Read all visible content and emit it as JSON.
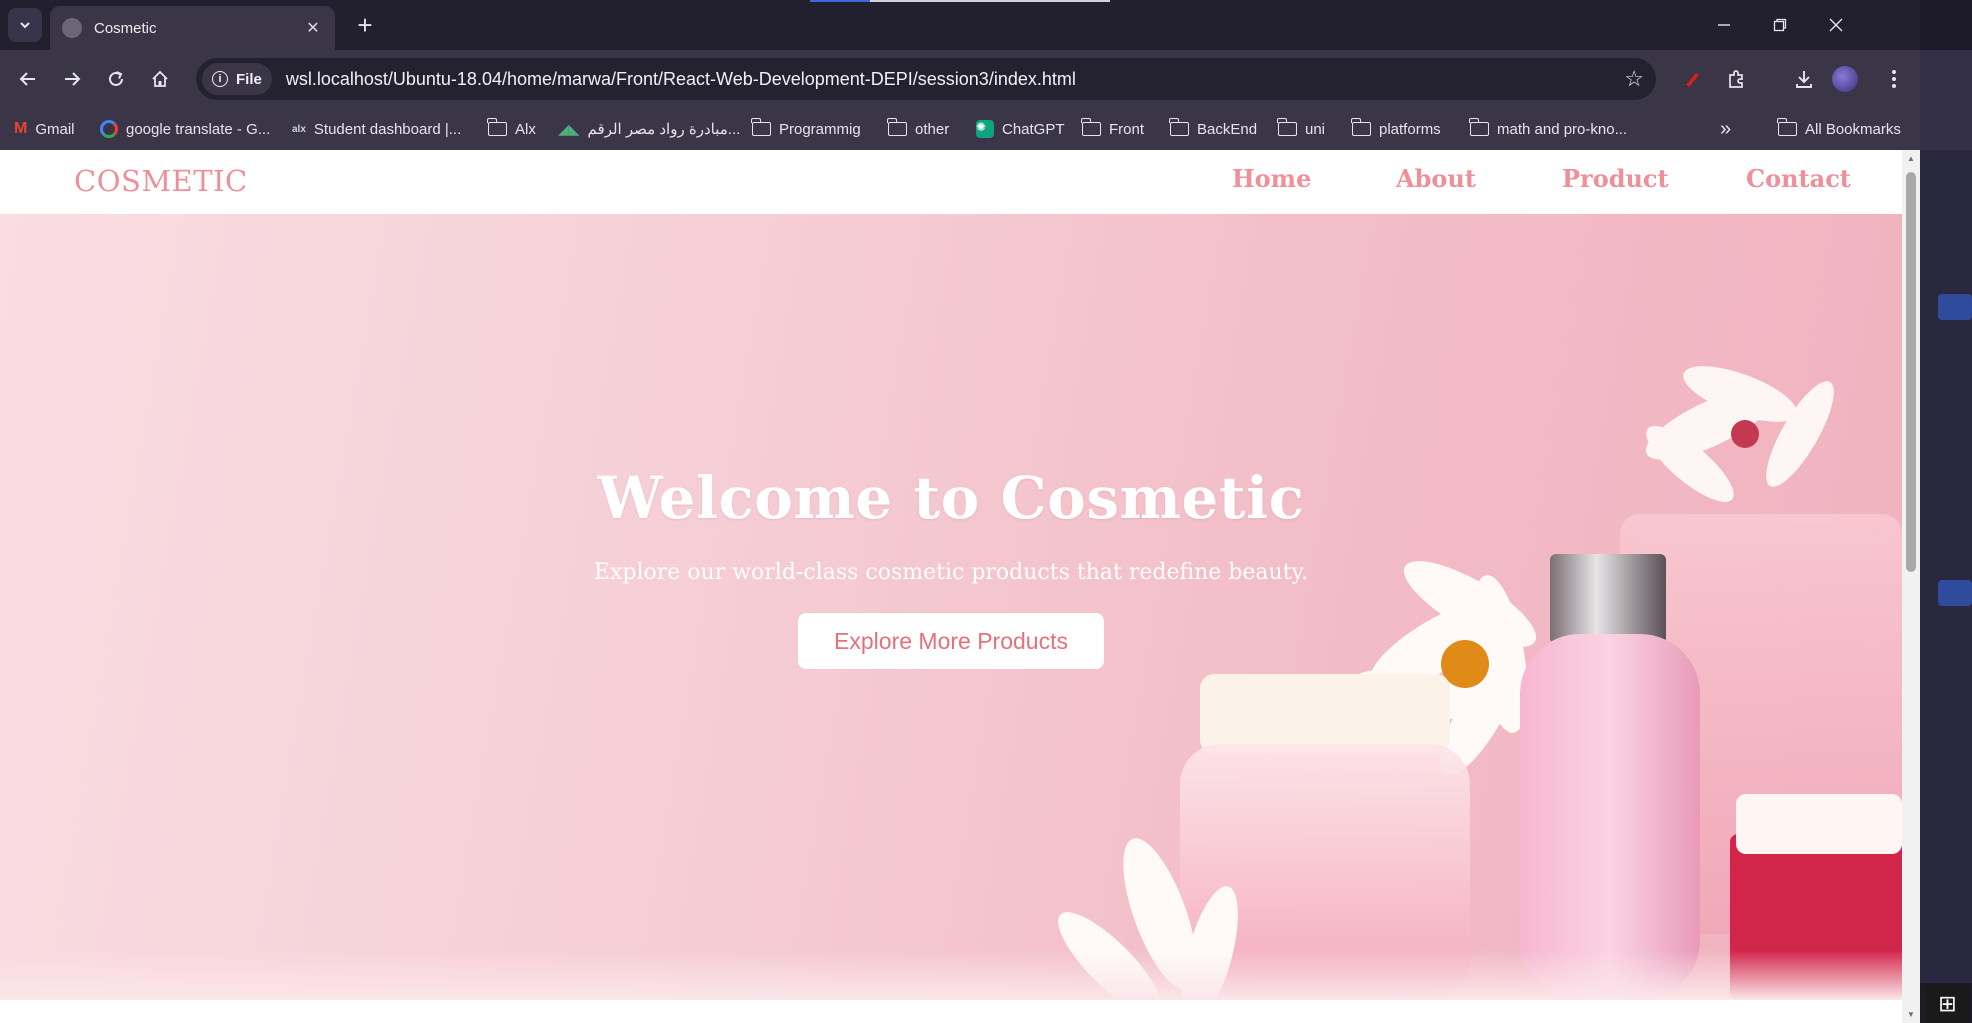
{
  "tab": {
    "title": "Cosmetic",
    "close_glyph": "✕",
    "new_tab_glyph": "+"
  },
  "address_bar": {
    "chip_label": "File",
    "url": "wsl.localhost/Ubuntu-18.04/home/marwa/Front/React-Web-Development-DEPI/session3/index.html"
  },
  "bookmarks": [
    {
      "label": "Gmail",
      "icon": "gmail-icon"
    },
    {
      "label": "google translate - G...",
      "icon": "google-icon"
    },
    {
      "label": "Student dashboard |...",
      "icon": "alx-icon"
    },
    {
      "label": "Alx",
      "icon": "folder-icon"
    },
    {
      "label": "مبادرة رواد مصر الرقم...",
      "icon": "depi-icon"
    },
    {
      "label": "Programmig",
      "icon": "folder-icon"
    },
    {
      "label": "other",
      "icon": "folder-icon"
    },
    {
      "label": "ChatGPT",
      "icon": "chatgpt-icon"
    },
    {
      "label": "Front",
      "icon": "folder-icon"
    },
    {
      "label": "BackEnd",
      "icon": "folder-icon"
    },
    {
      "label": "uni",
      "icon": "folder-icon"
    },
    {
      "label": "platforms",
      "icon": "folder-icon"
    },
    {
      "label": "math and pro-kno...",
      "icon": "folder-icon"
    }
  ],
  "bookmarks_overflow": "»",
  "all_bookmarks": "All Bookmarks",
  "site": {
    "logo": "COSMETIC",
    "nav": [
      "Home",
      "About",
      "Product",
      "Contact"
    ],
    "hero": {
      "title": "Welcome to Cosmetic",
      "subtitle": "Explore our world-class cosmetic products that redefine beauty.",
      "cta": "Explore More Products"
    }
  },
  "colors": {
    "brand_pink": "#ee8f99",
    "cta_text": "#e66f7c",
    "hero_bg": "#f6cfd6"
  }
}
